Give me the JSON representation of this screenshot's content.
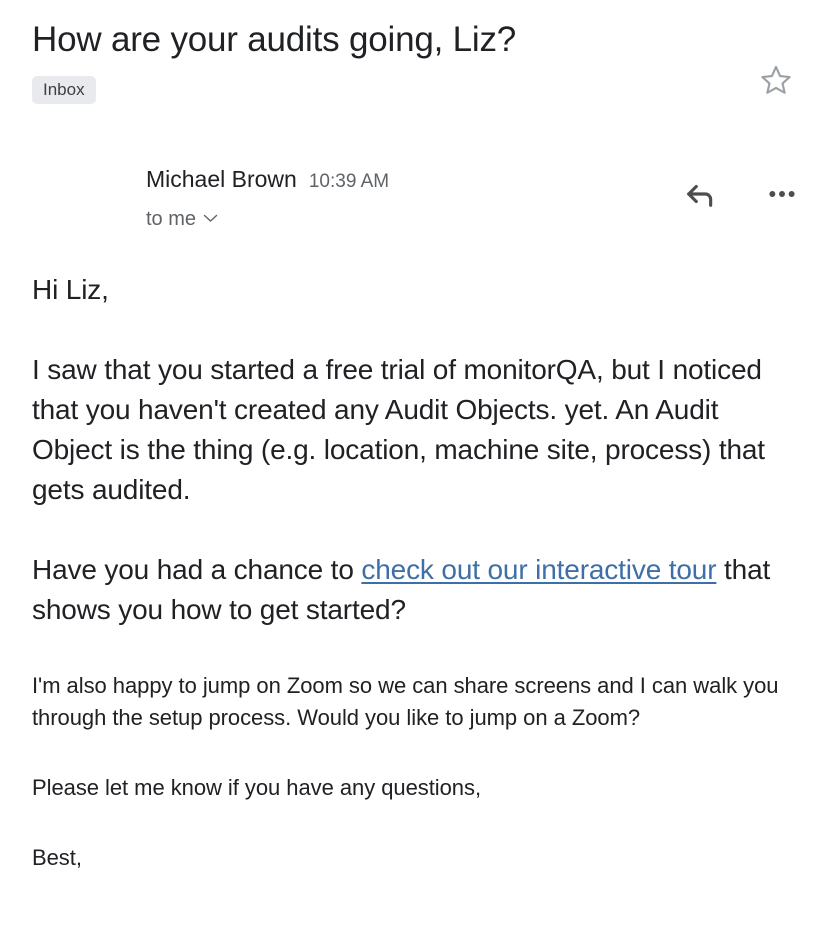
{
  "email": {
    "subject": "How are your audits going, Liz?",
    "label": "Inbox",
    "star_icon": "star-outline-icon",
    "sender": {
      "name": "Michael Brown",
      "time": "10:39 AM",
      "recipient": "to me",
      "recipient_chevron_icon": "chevron-down-icon"
    },
    "actions": {
      "reply_icon": "reply-arrow-icon",
      "more_icon": "more-options-icon"
    },
    "body": {
      "greeting": "Hi Liz,",
      "paragraph_1": "I saw that you started a free trial of monitorQA, but I noticed that you haven't created any Audit Objects. yet. An Audit Object is the thing (e.g. location, machine site, process) that gets audited.",
      "paragraph_2_before_link": "Have you had a chance to ",
      "paragraph_2_link": "check out our interactive tour",
      "paragraph_2_after_link": " that shows you how to get started?",
      "paragraph_3": "I'm also happy to jump on Zoom so we can share screens and I can walk you through the setup process. Would you like to jump on a Zoom?",
      "paragraph_4": "Please let me know if you have any questions,",
      "signoff": "Best,"
    }
  },
  "colors": {
    "background": "#ffffff",
    "text_primary": "#202124",
    "text_secondary": "#5f6368",
    "label_chip_bg": "#e8eaed",
    "link": "#3f6fa8",
    "icon_gray": "#5f6368",
    "star_outline": "#9aa0a6"
  }
}
